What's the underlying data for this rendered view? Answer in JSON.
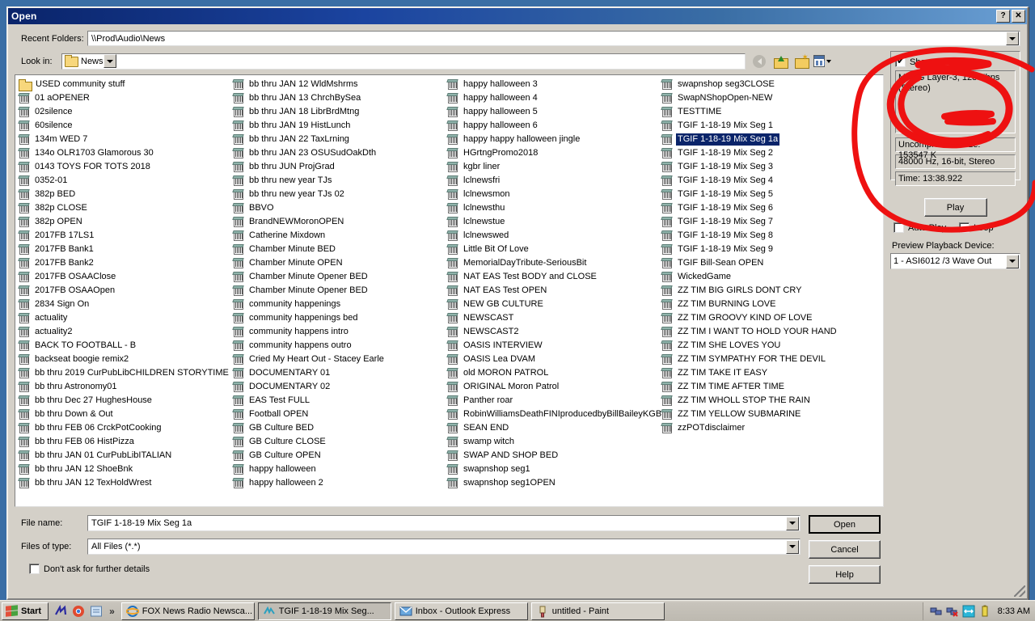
{
  "window": {
    "title": "Open",
    "help_button": "?",
    "close_button": "✕"
  },
  "recent_folders": {
    "label": "Recent Folders:",
    "value": "\\\\Prod\\Audio\\News"
  },
  "look_in": {
    "label": "Look in:",
    "value": "News",
    "toolbar": {
      "back": "back-icon",
      "up": "up-one-level-icon",
      "new_folder": "new-folder-icon",
      "views": "views-icon"
    }
  },
  "file_list": {
    "columns": [
      {
        "items": [
          {
            "name": "USED community stuff",
            "type": "folder"
          },
          {
            "name": "01 aOPENER",
            "type": "wave"
          },
          {
            "name": "02silence",
            "type": "wave"
          },
          {
            "name": "60silence",
            "type": "wave"
          },
          {
            "name": "134m WED 7",
            "type": "wave"
          },
          {
            "name": "134o OLR1703 Glamorous 30",
            "type": "wave"
          },
          {
            "name": "0143 TOYS FOR TOTS 2018",
            "type": "wave"
          },
          {
            "name": "0352-01",
            "type": "wave"
          },
          {
            "name": "382p BED",
            "type": "wave"
          },
          {
            "name": "382p CLOSE",
            "type": "wave"
          },
          {
            "name": "382p OPEN",
            "type": "wave"
          },
          {
            "name": "2017FB 17LS1",
            "type": "wave"
          },
          {
            "name": "2017FB Bank1",
            "type": "wave"
          },
          {
            "name": "2017FB Bank2",
            "type": "wave"
          },
          {
            "name": "2017FB OSAAClose",
            "type": "wave"
          },
          {
            "name": "2017FB OSAAOpen",
            "type": "wave"
          },
          {
            "name": "2834 Sign On",
            "type": "wave"
          },
          {
            "name": "actuality",
            "type": "wave"
          },
          {
            "name": "actuality2",
            "type": "wave"
          },
          {
            "name": "BACK TO FOOTBALL - B",
            "type": "wave"
          },
          {
            "name": "backseat boogie remix2",
            "type": "wave"
          },
          {
            "name": "bb thru 2019 CurPubLibCHILDREN STORYTIME",
            "type": "wave"
          },
          {
            "name": "bb thru Astronomy01",
            "type": "wave"
          },
          {
            "name": "bb thru Dec 27 HughesHouse",
            "type": "wave"
          },
          {
            "name": "bb thru Down & Out",
            "type": "wave"
          },
          {
            "name": "bb thru FEB 06 CrckPotCooking",
            "type": "wave"
          },
          {
            "name": "bb thru FEB 06 HistPizza",
            "type": "wave"
          },
          {
            "name": "bb thru JAN 01 CurPubLibITALIAN",
            "type": "wave"
          },
          {
            "name": "bb thru JAN 12 ShoeBnk",
            "type": "wave"
          },
          {
            "name": "bb thru JAN 12 TexHoldWrest",
            "type": "wave"
          }
        ]
      },
      {
        "items": [
          {
            "name": "bb thru JAN 12 WldMshrms",
            "type": "wave"
          },
          {
            "name": "bb thru JAN 13 ChrchBySea",
            "type": "wave"
          },
          {
            "name": "bb thru JAN 18 LibrBrdMtng",
            "type": "wave"
          },
          {
            "name": "bb thru JAN 19 HistLunch",
            "type": "wave"
          },
          {
            "name": "bb thru JAN 22 TaxLrning",
            "type": "wave"
          },
          {
            "name": "bb thru JAN 23 OSUSudOakDth",
            "type": "wave"
          },
          {
            "name": "bb thru JUN ProjGrad",
            "type": "wave"
          },
          {
            "name": "bb thru new year TJs",
            "type": "wave"
          },
          {
            "name": "bb thru new year TJs 02",
            "type": "wave"
          },
          {
            "name": "BBVO",
            "type": "wave"
          },
          {
            "name": "BrandNEWMoronOPEN",
            "type": "wave"
          },
          {
            "name": "Catherine Mixdown",
            "type": "wave"
          },
          {
            "name": "Chamber Minute BED",
            "type": "wave"
          },
          {
            "name": "Chamber Minute OPEN",
            "type": "wave"
          },
          {
            "name": "Chamber Minute Opener BED",
            "type": "wave"
          },
          {
            "name": "Chamber Minute Opener BED",
            "type": "wave"
          },
          {
            "name": "community happenings",
            "type": "wave"
          },
          {
            "name": "community happenings bed",
            "type": "wave"
          },
          {
            "name": "community happens intro",
            "type": "wave"
          },
          {
            "name": "community happens outro",
            "type": "wave"
          },
          {
            "name": "Cried My Heart Out - Stacey Earle",
            "type": "wave"
          },
          {
            "name": "DOCUMENTARY 01",
            "type": "wave"
          },
          {
            "name": "DOCUMENTARY 02",
            "type": "wave"
          },
          {
            "name": "EAS Test FULL",
            "type": "wave"
          },
          {
            "name": "Football OPEN",
            "type": "wave"
          },
          {
            "name": "GB Culture BED",
            "type": "wave"
          },
          {
            "name": "GB Culture CLOSE",
            "type": "wave"
          },
          {
            "name": "GB Culture OPEN",
            "type": "wave"
          },
          {
            "name": "happy halloween",
            "type": "wave"
          },
          {
            "name": "happy halloween 2",
            "type": "wave"
          }
        ]
      },
      {
        "items": [
          {
            "name": "happy halloween 3",
            "type": "wave"
          },
          {
            "name": "happy halloween 4",
            "type": "wave"
          },
          {
            "name": "happy halloween 5",
            "type": "wave"
          },
          {
            "name": "happy halloween 6",
            "type": "wave"
          },
          {
            "name": "happy happy halloween jingle",
            "type": "wave"
          },
          {
            "name": "HGrtngPromo2018",
            "type": "wave"
          },
          {
            "name": "kgbr liner",
            "type": "wave"
          },
          {
            "name": "lclnewsfri",
            "type": "wave"
          },
          {
            "name": "lclnewsmon",
            "type": "wave"
          },
          {
            "name": "lclnewsthu",
            "type": "wave"
          },
          {
            "name": "lclnewstue",
            "type": "wave"
          },
          {
            "name": "lclnewswed",
            "type": "wave"
          },
          {
            "name": "Little Bit Of Love",
            "type": "wave"
          },
          {
            "name": "MemorialDayTribute-SeriousBit",
            "type": "wave"
          },
          {
            "name": "NAT EAS Test BODY and CLOSE",
            "type": "wave"
          },
          {
            "name": "NAT EAS Test OPEN",
            "type": "wave"
          },
          {
            "name": "NEW GB CULTURE",
            "type": "wave"
          },
          {
            "name": "NEWSCAST",
            "type": "wave"
          },
          {
            "name": "NEWSCAST2",
            "type": "wave"
          },
          {
            "name": "OASIS INTERVIEW",
            "type": "wave"
          },
          {
            "name": "OASIS Lea DVAM",
            "type": "wave"
          },
          {
            "name": "old MORON PATROL",
            "type": "wave"
          },
          {
            "name": "ORIGINAL Moron Patrol",
            "type": "wave"
          },
          {
            "name": "Panther roar",
            "type": "wave"
          },
          {
            "name": "RobinWilliamsDeathFINIproducedbyBillBaileyKGBR",
            "type": "wave"
          },
          {
            "name": "SEAN END",
            "type": "wave"
          },
          {
            "name": "swamp witch",
            "type": "wave"
          },
          {
            "name": "SWAP AND SHOP BED",
            "type": "wave"
          },
          {
            "name": "swapnshop seg1",
            "type": "wave"
          },
          {
            "name": "swapnshop seg1OPEN",
            "type": "wave"
          }
        ]
      },
      {
        "items": [
          {
            "name": "swapnshop seg3CLOSE",
            "type": "wave"
          },
          {
            "name": "SwapNShopOpen-NEW",
            "type": "wave"
          },
          {
            "name": "TESTTIME",
            "type": "wave"
          },
          {
            "name": "TGIF 1-18-19 Mix Seg 1",
            "type": "wave"
          },
          {
            "name": "TGIF 1-18-19 Mix Seg 1a",
            "type": "wave",
            "selected": true
          },
          {
            "name": "TGIF 1-18-19 Mix Seg 2",
            "type": "wave"
          },
          {
            "name": "TGIF 1-18-19 Mix Seg 3",
            "type": "wave"
          },
          {
            "name": "TGIF 1-18-19 Mix Seg 4",
            "type": "wave"
          },
          {
            "name": "TGIF 1-18-19 Mix Seg 5",
            "type": "wave"
          },
          {
            "name": "TGIF 1-18-19 Mix Seg 6",
            "type": "wave"
          },
          {
            "name": "TGIF 1-18-19 Mix Seg 7",
            "type": "wave"
          },
          {
            "name": "TGIF 1-18-19 Mix Seg 8",
            "type": "wave"
          },
          {
            "name": "TGIF 1-18-19 Mix Seg 9",
            "type": "wave"
          },
          {
            "name": "TGIF Bill-Sean OPEN",
            "type": "wave"
          },
          {
            "name": "WickedGame",
            "type": "wave"
          },
          {
            "name": "ZZ TIM BIG GIRLS DONT CRY",
            "type": "wave"
          },
          {
            "name": "ZZ TIM BURNING LOVE",
            "type": "wave"
          },
          {
            "name": "ZZ TIM GROOVY KIND OF LOVE",
            "type": "wave"
          },
          {
            "name": "ZZ TIM I WANT TO HOLD YOUR HAND",
            "type": "wave"
          },
          {
            "name": "ZZ TIM SHE LOVES YOU",
            "type": "wave"
          },
          {
            "name": "ZZ TIM SYMPATHY FOR THE DEVIL",
            "type": "wave"
          },
          {
            "name": "ZZ TIM TAKE IT EASY",
            "type": "wave"
          },
          {
            "name": "ZZ TIM TIME AFTER TIME",
            "type": "wave"
          },
          {
            "name": "ZZ TIM WHOLL STOP THE RAIN",
            "type": "wave"
          },
          {
            "name": "ZZ TIM YELLOW SUBMARINE",
            "type": "wave"
          },
          {
            "name": "zzPOTdisclaimer",
            "type": "wave"
          }
        ]
      }
    ]
  },
  "form": {
    "file_name_label": "File name:",
    "file_name_value": "TGIF 1-18-19 Mix Seg 1a",
    "files_of_type_label": "Files of type:",
    "files_of_type_value": "All Files (*.*)",
    "dont_ask_label": "Don't ask for further details",
    "dont_ask_checked": false
  },
  "buttons": {
    "open": "Open",
    "cancel": "Cancel",
    "help": "Help"
  },
  "info_panel": {
    "show_info_label": "Show",
    "show_info_checked": true,
    "format": "MPEG Layer-3, 128 Kbps (Stereo)",
    "uncompressed_size": "Uncompressed Size: 153547 K",
    "sample_rate": "48000 Hz, 16-bit, Stereo",
    "time": "Time:  13:38.922"
  },
  "playback": {
    "play_button": "Play",
    "auto_play_label": "Auto Play",
    "auto_play_checked": false,
    "loop_label": "Loop",
    "loop_checked": false,
    "device_label": "Preview Playback Device:",
    "device_value": "1 - ASI6012 /3 Wave Out"
  },
  "taskbar": {
    "start_label": "Start",
    "chevron": "»",
    "tasks": [
      {
        "label": "FOX News Radio Newsca...",
        "active": false,
        "icon": "ie-icon"
      },
      {
        "label": "TGIF 1-18-19 Mix Seg...",
        "active": true,
        "icon": "audio-editor-icon"
      },
      {
        "label": "Inbox - Outlook Express",
        "active": false,
        "icon": "outlook-icon"
      },
      {
        "label": "untitled - Paint",
        "active": false,
        "icon": "paint-icon"
      }
    ],
    "clock": "8:33 AM"
  },
  "annotation": {
    "color": "#ee1111",
    "description": "hand-drawn red circle and scribble over the file-format info box"
  }
}
